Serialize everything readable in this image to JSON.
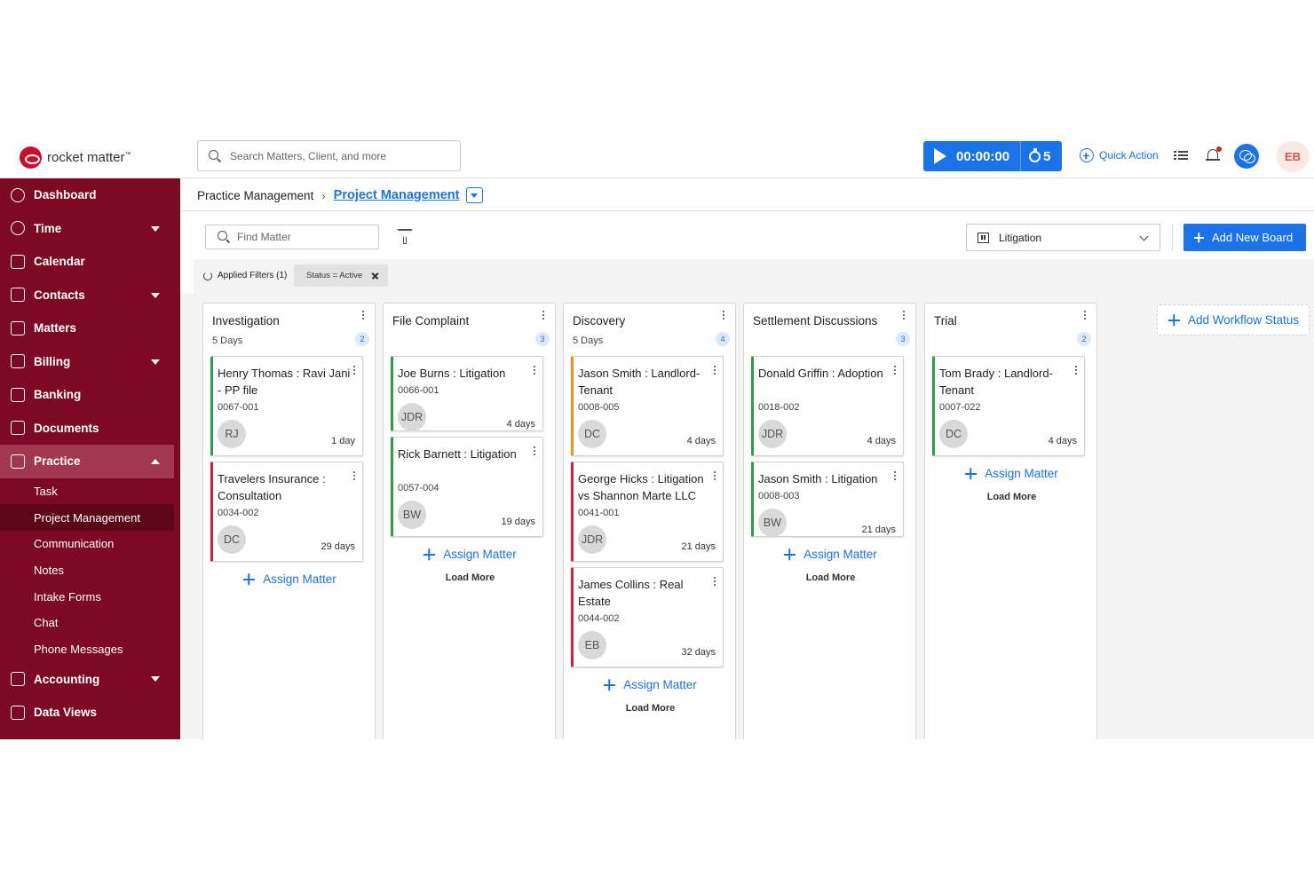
{
  "brand": {
    "name": "rocket matter",
    "tm": "™"
  },
  "search": {
    "placeholder": "Search Matters, Client, and more"
  },
  "timer": {
    "time": "00:00:00",
    "count": "5"
  },
  "header": {
    "quick_action": "Quick Action",
    "user_initials": "EB"
  },
  "sidebar": {
    "items": [
      {
        "label": "Dashboard",
        "icon": "dashboard-icon",
        "caret": false
      },
      {
        "label": "Time",
        "icon": "clock-icon",
        "caret": true
      },
      {
        "label": "Calendar",
        "icon": "calendar-icon",
        "caret": false
      },
      {
        "label": "Contacts",
        "icon": "contacts-icon",
        "caret": true
      },
      {
        "label": "Matters",
        "icon": "folder-icon",
        "caret": false
      },
      {
        "label": "Billing",
        "icon": "billing-icon",
        "caret": true
      },
      {
        "label": "Banking",
        "icon": "bank-icon",
        "caret": false
      },
      {
        "label": "Documents",
        "icon": "documents-icon",
        "caret": false
      },
      {
        "label": "Practice",
        "icon": "scales-icon",
        "caret": true,
        "expanded": true
      }
    ],
    "sub_items": [
      "Task",
      "Project Management",
      "Communication",
      "Notes",
      "Intake Forms",
      "Chat",
      "Phone Messages"
    ],
    "bottom_items": [
      {
        "label": "Accounting",
        "icon": "calculator-icon",
        "caret": true
      },
      {
        "label": "Data Views",
        "icon": "table-icon",
        "caret": false
      }
    ],
    "active_sub": "Project Management"
  },
  "breadcrumb": {
    "parent": "Practice Management",
    "current": "Project Management"
  },
  "toolbar": {
    "find_placeholder": "Find Matter",
    "board": "Litigation",
    "add_board": "Add New Board"
  },
  "filters": {
    "applied": "Applied Filters (1)",
    "chip": "Status = Active"
  },
  "columns": [
    {
      "title": "Investigation",
      "days": "5 Days",
      "count": "2",
      "cards": [
        {
          "name": "Henry Thomas : Ravi Jani - PP file",
          "number": "0067-001",
          "initials": "RJ",
          "age": "1 day",
          "color": "#2e9d4a"
        },
        {
          "name": "Travelers Insurance : Consultation",
          "number": "0034-002",
          "initials": "DC",
          "age": "29 days",
          "color": "#d0213d"
        }
      ]
    },
    {
      "title": "File Complaint",
      "days": "",
      "count": "3",
      "cards": [
        {
          "name": "Joe Burns : Litigation",
          "number": "0066-001",
          "initials": "JDR",
          "age": "4 days",
          "color": "#2e9d4a"
        },
        {
          "name": "Rick Barnett : Litigation",
          "number": "0057-004",
          "initials": "BW",
          "age": "19 days",
          "color": "#2e9d4a"
        }
      ]
    },
    {
      "title": "Discovery",
      "days": "5 Days",
      "count": "4",
      "cards": [
        {
          "name": "Jason Smith : Landlord-Tenant",
          "number": "0008-005",
          "initials": "DC",
          "age": "4 days",
          "color": "#f0901b"
        },
        {
          "name": "George Hicks : Litigation vs Shannon Marte LLC",
          "number": "0041-001",
          "initials": "JDR",
          "age": "21 days",
          "color": "#d0213d"
        },
        {
          "name": "James Collins : Real Estate",
          "number": "0044-002",
          "initials": "EB",
          "age": "32 days",
          "color": "#d0213d"
        }
      ]
    },
    {
      "title": "Settlement Discussions",
      "days": "",
      "count": "3",
      "cards": [
        {
          "name": "Donald Griffin : Adoption",
          "number": "0018-002",
          "initials": "JDR",
          "age": "4 days",
          "color": "#2e9d4a"
        },
        {
          "name": "Jason Smith : Litigation",
          "number": "0008-003",
          "initials": "BW",
          "age": "21 days",
          "color": "#2e9d4a"
        }
      ]
    },
    {
      "title": "Trial",
      "days": "",
      "count": "2",
      "cards": [
        {
          "name": "Tom Brady : Landlord-Tenant",
          "number": "0007-022",
          "initials": "DC",
          "age": "4 days",
          "color": "#2e9d4a"
        }
      ]
    }
  ],
  "board_actions": {
    "assign": "Assign Matter",
    "load_more": "Load More",
    "add_workflow": "Add Workflow Status"
  },
  "colors": {
    "sidebar": "#7d0a24",
    "accent": "#1a73e8",
    "brand_red": "#c8102e"
  }
}
